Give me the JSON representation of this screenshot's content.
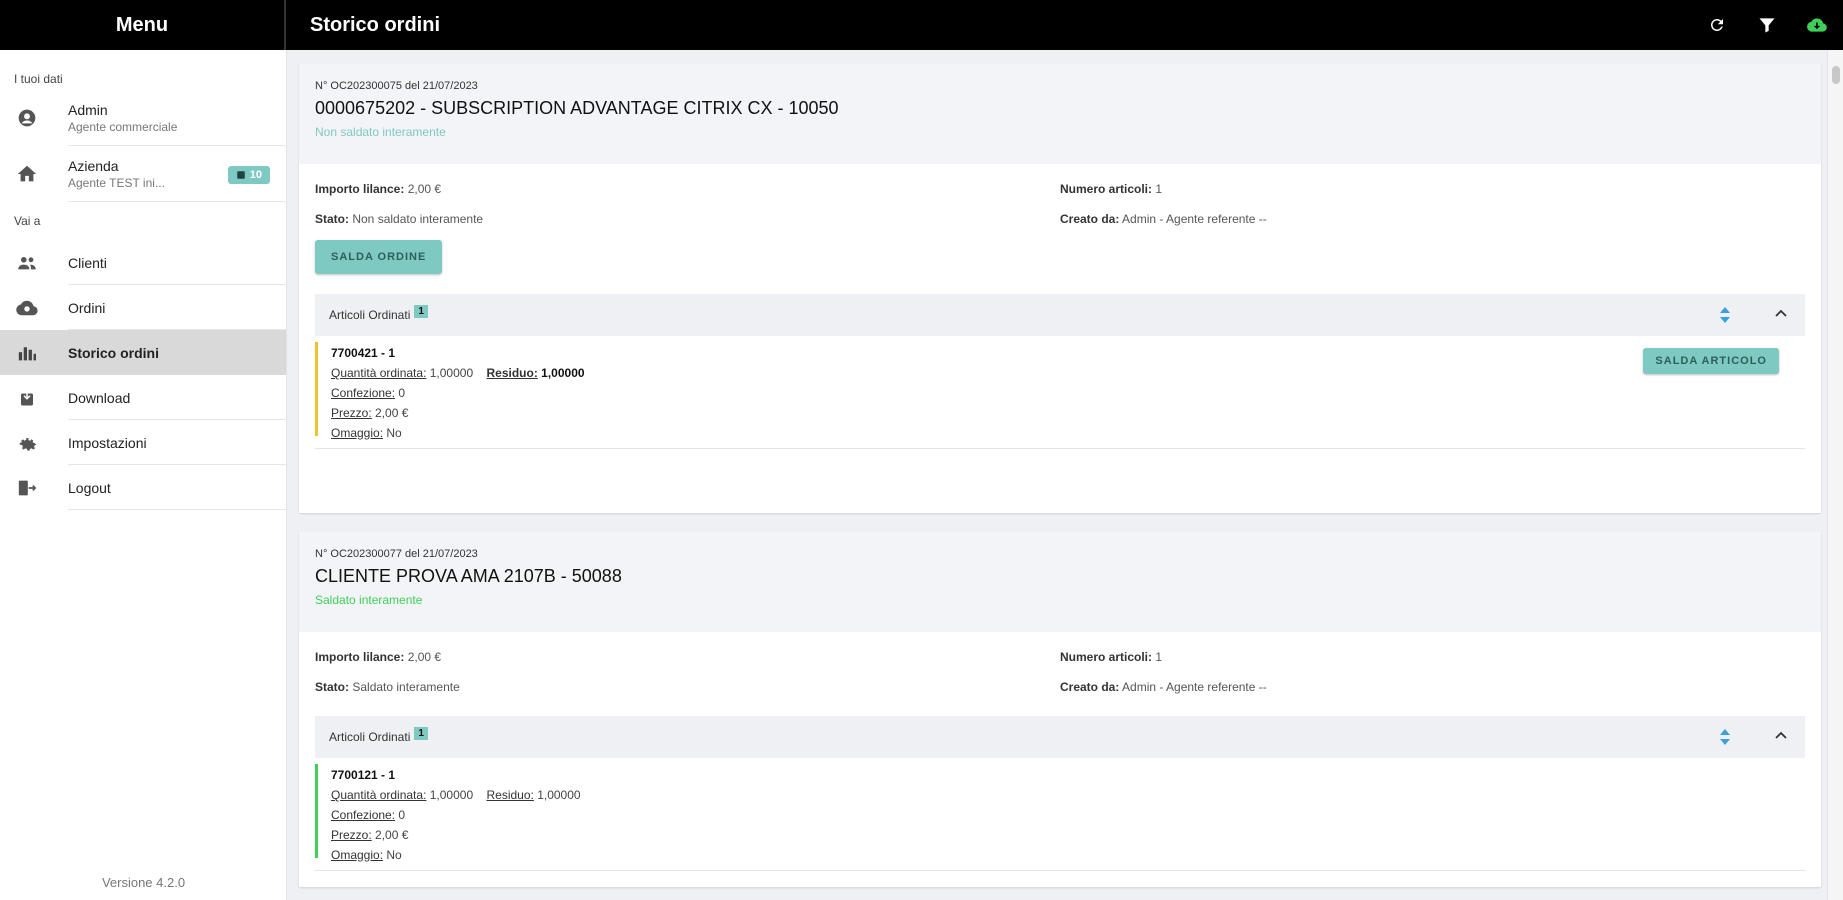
{
  "header": {
    "menu_title": "Menu",
    "page_title": "Storico ordini"
  },
  "sidebar": {
    "section_user": "I tuoi dati",
    "user": {
      "name": "Admin",
      "role": "Agente commerciale"
    },
    "company": {
      "name": "Azienda",
      "sub": "Agente TEST ini...",
      "badge": "10"
    },
    "section_nav": "Vai a",
    "items": [
      {
        "label": "Clienti"
      },
      {
        "label": "Ordini"
      },
      {
        "label": "Storico ordini"
      },
      {
        "label": "Download"
      },
      {
        "label": "Impostazioni"
      },
      {
        "label": "Logout"
      }
    ],
    "version": "Versione 4.2.0"
  },
  "orders": [
    {
      "number": "N° OC202300075 del 21/07/2023",
      "title": "0000675202 - SUBSCRIPTION ADVANTAGE CITRIX CX - 10050",
      "status_text": "Non saldato interamente",
      "status_color": "#7fc9c3",
      "importo_label": "Importo lilance:",
      "importo_value": "2,00 €",
      "numero_label": "Numero articoli:",
      "numero_value": "1",
      "stato_label": "Stato:",
      "stato_value": "Non saldato interamente",
      "creato_label": "Creato da:",
      "creato_value": "Admin - Agente referente --",
      "saldo_button": "SALDA ORDINE",
      "articoli_label": "Articoli Ordinati",
      "articoli_count": "1",
      "items": [
        {
          "code": "7700421 - 1",
          "qty_label": "Quantità ordinata:",
          "qty_value": "1,00000",
          "res_label": "Residuo:",
          "res_value": "1,00000",
          "conf_label": "Confezione:",
          "conf_value": "0",
          "prezzo_label": "Prezzo:",
          "prezzo_value": "2,00 €",
          "omaggio_label": "Omaggio:",
          "omaggio_value": "No",
          "bar_color": "#f2c230",
          "saldo_button": "SALDA ARTICOLO"
        }
      ]
    },
    {
      "number": "N° OC202300077 del 21/07/2023",
      "title": "CLIENTE PROVA AMA 2107B - 50088",
      "status_text": "Saldato interamente",
      "status_color": "#3fcf58",
      "importo_label": "Importo lilance:",
      "importo_value": "2,00 €",
      "numero_label": "Numero articoli:",
      "numero_value": "1",
      "stato_label": "Stato:",
      "stato_value": "Saldato interamente",
      "creato_label": "Creato da:",
      "creato_value": "Admin - Agente referente --",
      "articoli_label": "Articoli Ordinati",
      "articoli_count": "1",
      "items": [
        {
          "code": "7700121 - 1",
          "qty_label": "Quantità ordinata:",
          "qty_value": "1,00000",
          "res_label": "Residuo:",
          "res_value": "1,00000",
          "conf_label": "Confezione:",
          "conf_value": "0",
          "prezzo_label": "Prezzo:",
          "prezzo_value": "2,00 €",
          "omaggio_label": "Omaggio:",
          "omaggio_value": "No",
          "bar_color": "#3fcf58"
        }
      ]
    }
  ],
  "colors": {
    "accent": "#7fc9c3",
    "cloud_icon": "#3fcf58",
    "sort_icon": "#3b9fe0"
  }
}
